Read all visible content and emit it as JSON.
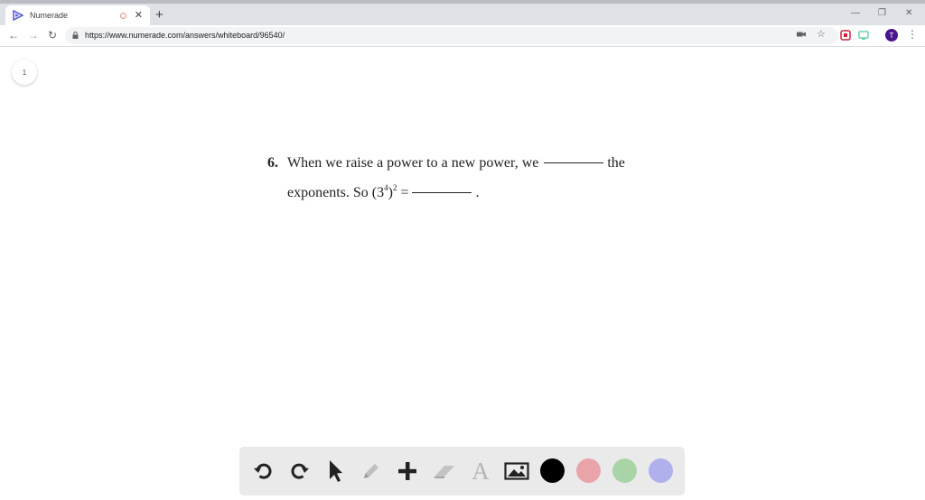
{
  "browser": {
    "tab": {
      "title": "Numerade"
    },
    "newtab_icon": "plus-icon",
    "address_bar": {
      "url": "https://www.numerade.com/answers/whiteboard/96540/"
    },
    "avatar_initial": "T",
    "window_controls": [
      "minimize-icon",
      "restore-icon",
      "close-icon"
    ]
  },
  "page": {
    "page_number": "1",
    "question": {
      "number": "6.",
      "line1_before": "When we raise a power to a new power, we",
      "line1_after": "the",
      "line2_before": "exponents. So (3",
      "exp_inner": "4",
      "paren_close": ")",
      "exp_outer": "2",
      "equals": " =",
      "period": "."
    }
  },
  "whiteboard_toolbar": {
    "tools": [
      "undo-icon",
      "redo-icon",
      "pointer-icon",
      "pencil-icon",
      "add-icon",
      "eraser-icon",
      "text-icon",
      "image-icon"
    ],
    "text_tool_glyph": "A",
    "colors": [
      "#000000",
      "#e8a4a8",
      "#a8d4a8",
      "#b0b0ec"
    ]
  }
}
